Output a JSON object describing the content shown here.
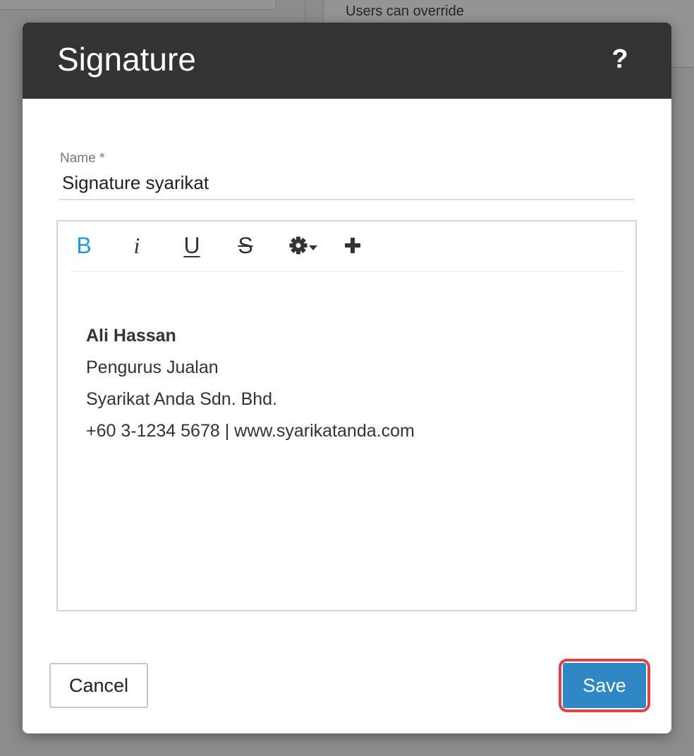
{
  "background": {
    "override_text": "Users can override"
  },
  "modal": {
    "title": "Signature",
    "help_label": "?"
  },
  "form": {
    "name_label": "Name *",
    "name_value": "Signature syarikat"
  },
  "toolbar": {
    "bold": "B",
    "italic": "i",
    "underline": "U",
    "strikethrough": "S",
    "settings_icon": "gear-icon",
    "add_icon": "plus-icon",
    "accent_color": "#1a9be0"
  },
  "editor": {
    "lines": [
      "Ali Hassan",
      "Pengurus Jualan",
      "Syarikat Anda Sdn. Bhd.",
      "+60 3-1234 5678 | www.syarikatanda.com"
    ]
  },
  "footer": {
    "cancel_label": "Cancel",
    "save_label": "Save",
    "save_color": "#2f87c4",
    "highlight_color": "#d9434b"
  }
}
